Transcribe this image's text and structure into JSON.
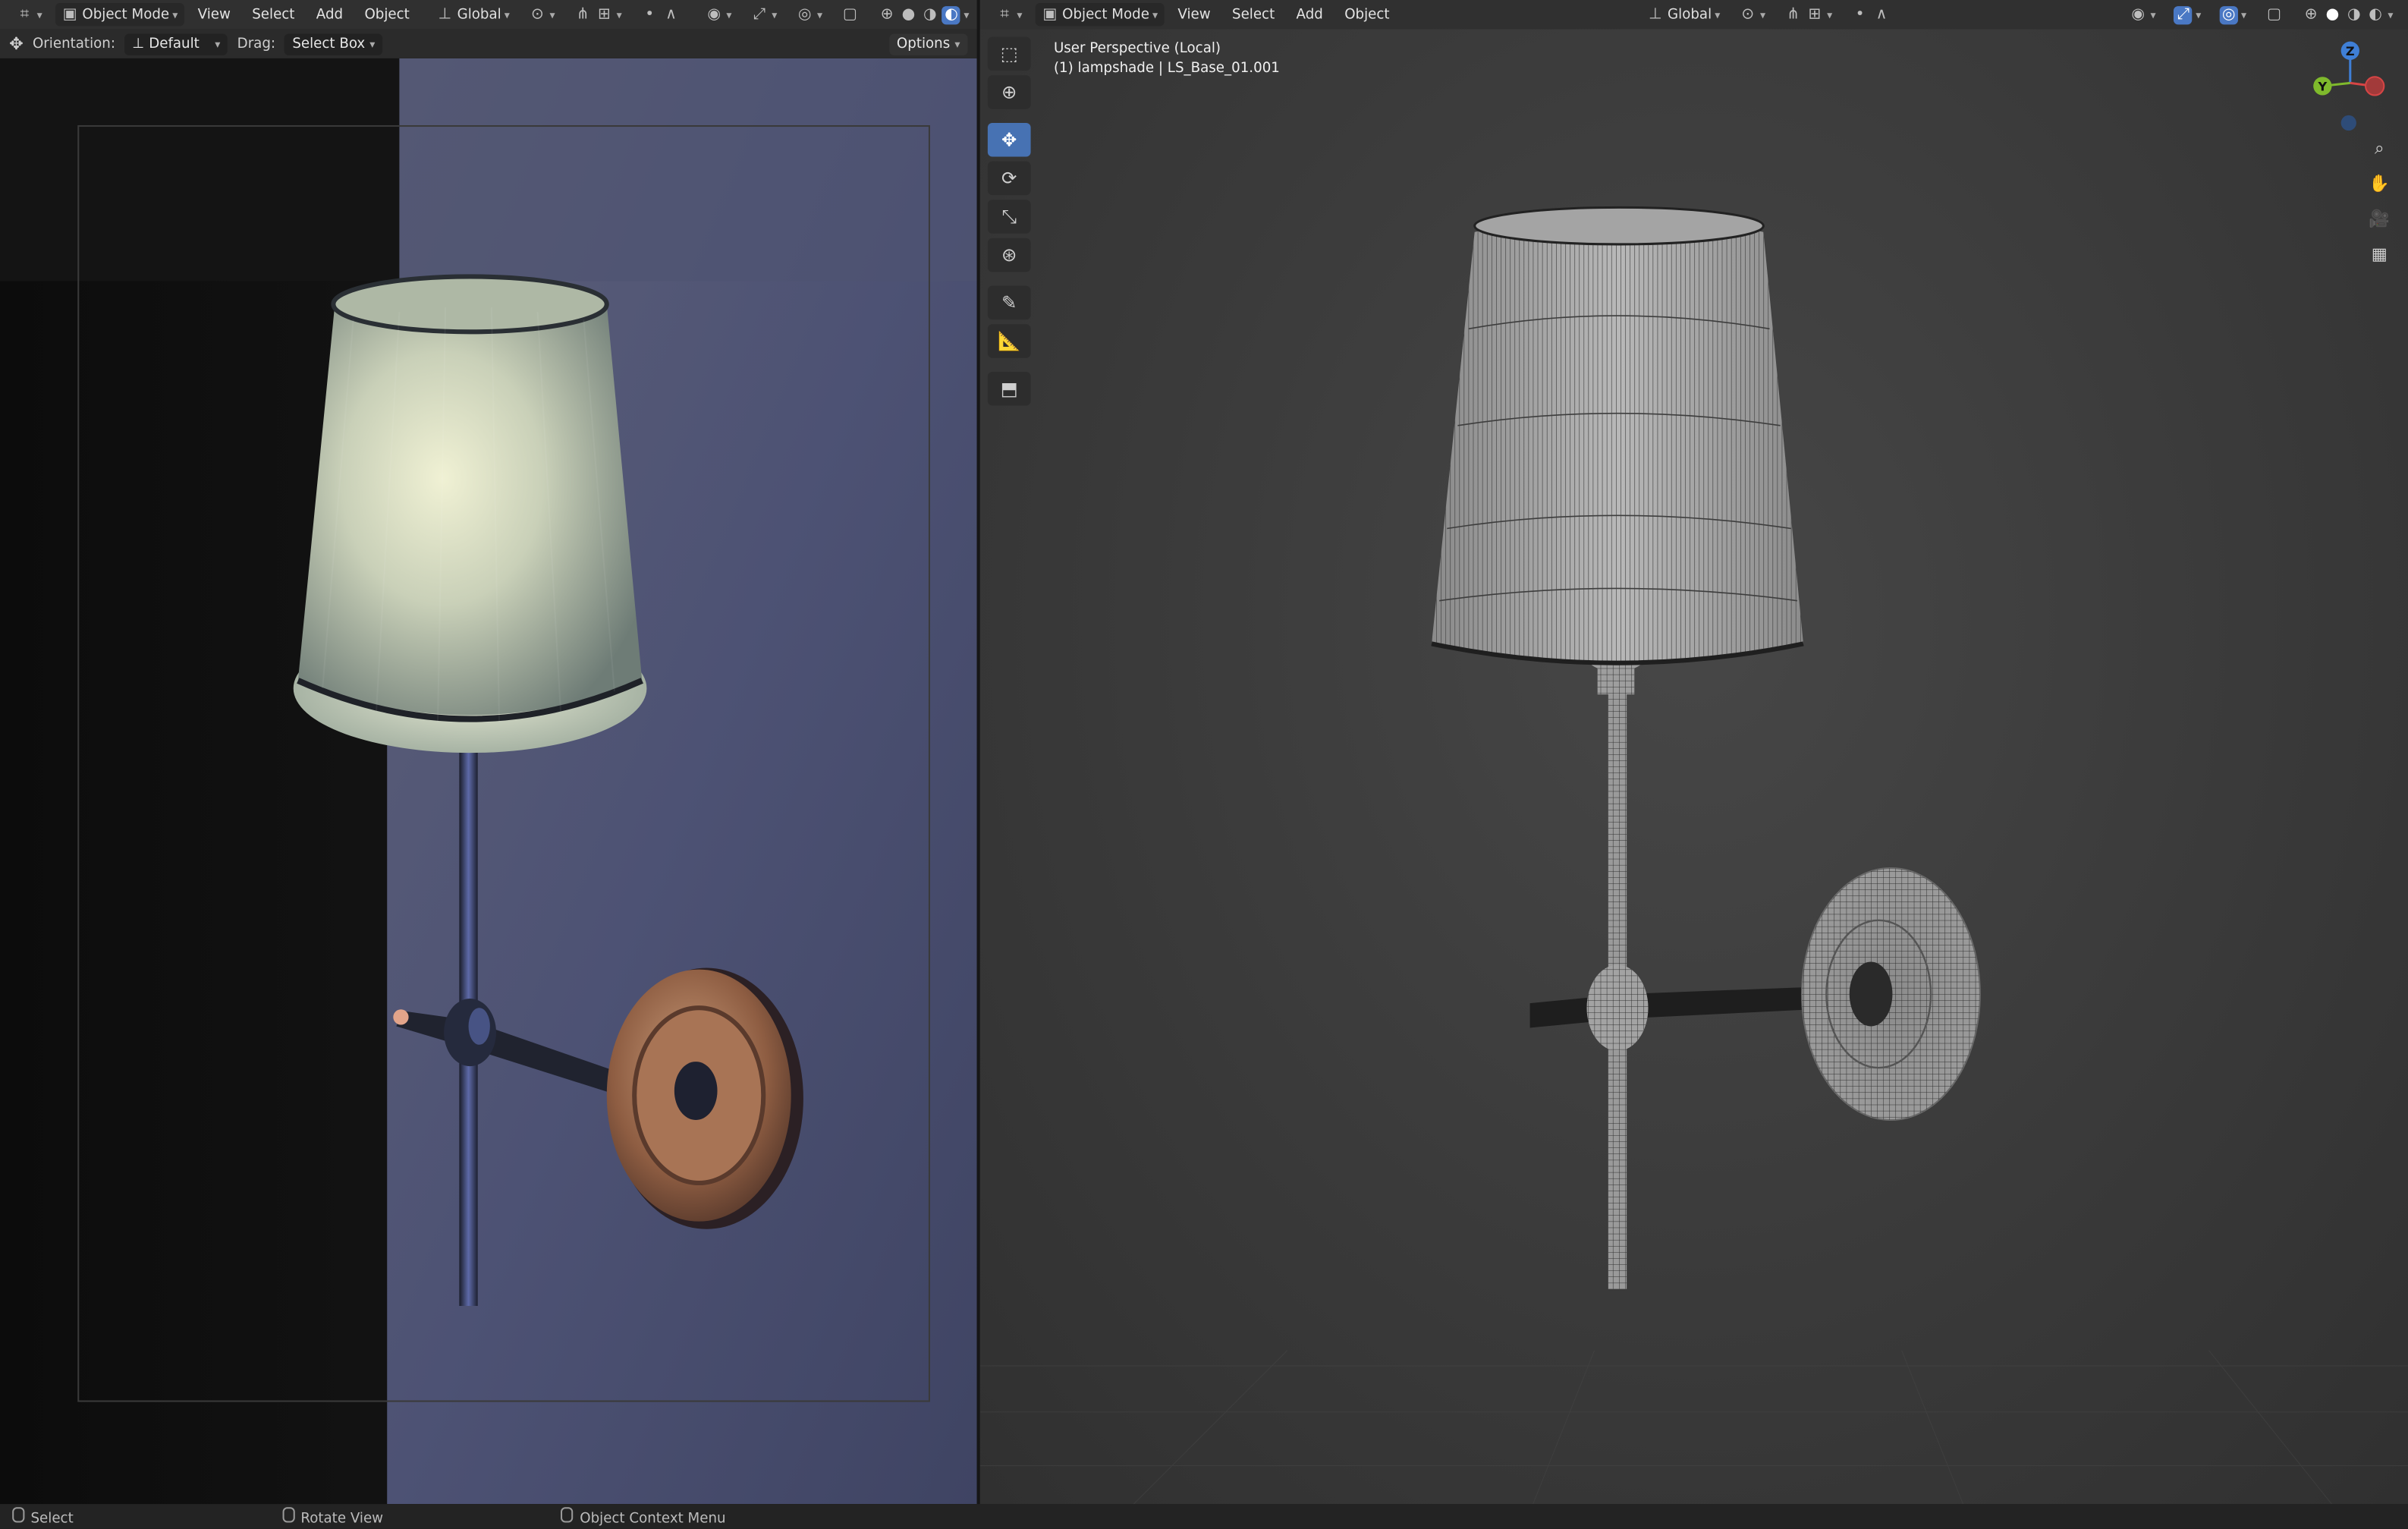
{
  "left_header": {
    "mode": "Object Mode",
    "menus": [
      "View",
      "Select",
      "Add",
      "Object"
    ],
    "transform": "Global"
  },
  "left_subheader": {
    "orientation_label": "Orientation:",
    "orientation_value": "Default",
    "drag_label": "Drag:",
    "drag_value": "Select Box",
    "options": "Options"
  },
  "right_header": {
    "mode": "Object Mode",
    "menus": [
      "View",
      "Select",
      "Add",
      "Object"
    ],
    "transform": "Global"
  },
  "viewport": {
    "perspective": "User Perspective (Local)",
    "object": "(1) lampshade | LS_Base_01.001"
  },
  "gizmo": {
    "z": "Z",
    "y": "Y"
  },
  "status_bar": {
    "select": "Select",
    "rotate": "Rotate View",
    "context": "Object Context Menu"
  },
  "colors": {
    "accent": "#4772b3",
    "header": "#303030",
    "axis_x": "#d64545",
    "axis_y": "#7fba2c",
    "axis_z": "#3f7fd6"
  },
  "icons": [
    "editor-type-icon",
    "object-mode-icon",
    "transform-pivot-icon",
    "snap-icon",
    "proportional-icon",
    "viewport-shading-icon",
    "select-box-icon",
    "cursor-icon",
    "move-icon",
    "rotate-icon",
    "scale-icon",
    "transform-icon",
    "annotate-icon",
    "measure-icon",
    "add-cube-icon",
    "zoom-icon",
    "hand-pan-icon",
    "camera-icon",
    "grid-icon"
  ]
}
